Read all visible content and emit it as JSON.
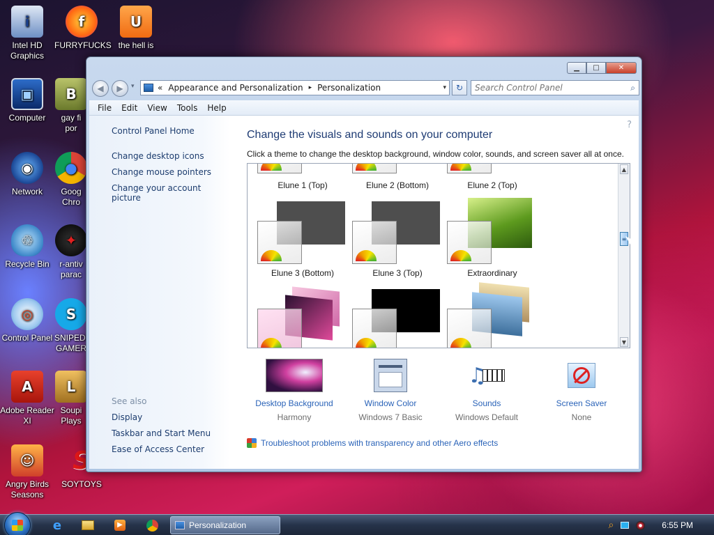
{
  "desktop": {
    "icons": [
      {
        "label": "Intel HD Graphics",
        "glyph": "i"
      },
      {
        "label": "FURRYFUCKS",
        "glyph": "f"
      },
      {
        "label": "the hell is",
        "glyph": "U"
      },
      {
        "label": "Computer",
        "glyph": "▣"
      },
      {
        "label": "gay fi por",
        "glyph": "B"
      },
      {
        "label": "Network",
        "glyph": "◉"
      },
      {
        "label": "Goog Chro",
        "glyph": "●"
      },
      {
        "label": "Recycle Bin",
        "glyph": "♲"
      },
      {
        "label": "r-antiv parac",
        "glyph": "✦"
      },
      {
        "label": "Control Panel",
        "glyph": "◎"
      },
      {
        "label": "SNIPED! GAMER",
        "glyph": "S"
      },
      {
        "label": "Adobe Reader XI",
        "glyph": "A"
      },
      {
        "label": "Soupi Plays",
        "glyph": "L"
      },
      {
        "label": "Angry Birds Seasons",
        "glyph": "☺"
      },
      {
        "label": "SOYTOYS",
        "glyph": "S"
      }
    ]
  },
  "window": {
    "title_controls": {
      "minimize": "▁",
      "maximize": "□",
      "close": "✕"
    },
    "nav": {
      "back": "◀",
      "forward": "▶",
      "history": "▾"
    },
    "address": {
      "lead": "«",
      "crumbs": [
        "Appearance and Personalization",
        "Personalization"
      ],
      "separator": "▸",
      "dropdown": "▾"
    },
    "refresh_glyph": "↻",
    "search": {
      "placeholder": "Search Control Panel",
      "icon": "⌕"
    },
    "menu": [
      "File",
      "Edit",
      "View",
      "Tools",
      "Help"
    ]
  },
  "sidebar": {
    "home": "Control Panel Home",
    "links": [
      "Change desktop icons",
      "Change mouse pointers",
      "Change your account picture"
    ],
    "see_also_heading": "See also",
    "see_also": [
      "Display",
      "Taskbar and Start Menu",
      "Ease of Access Center"
    ]
  },
  "main": {
    "help_glyph": "?",
    "title": "Change the visuals and sounds on your computer",
    "description": "Click a theme to change the desktop background, window color, sounds, and screen saver all at once.",
    "themes": [
      {
        "label": "Elune 1 (Top)",
        "style": "dark"
      },
      {
        "label": "Elune 2 (Bottom)",
        "style": "dark"
      },
      {
        "label": "Elune 2 (Top)",
        "style": "dark"
      },
      {
        "label": "Elune 3 (Bottom)",
        "style": "dark"
      },
      {
        "label": "Elune 3 (Top)",
        "style": "dark"
      },
      {
        "label": "Extraordinary",
        "style": "grass"
      },
      {
        "label": "",
        "style": "pinkstack"
      },
      {
        "label": "",
        "style": "black"
      },
      {
        "label": "",
        "style": "landscapestack"
      }
    ],
    "scroll": {
      "up": "▲",
      "down": "▼",
      "thumb": "≡"
    },
    "settings": [
      {
        "name": "Desktop Background",
        "value": "Harmony"
      },
      {
        "name": "Window Color",
        "value": "Windows 7 Basic"
      },
      {
        "name": "Sounds",
        "value": "Windows Default"
      },
      {
        "name": "Screen Saver",
        "value": "None"
      }
    ],
    "troubleshoot": "Troubleshoot problems with transparency and other Aero effects"
  },
  "taskbar": {
    "pinned": [
      "internet-explorer-icon",
      "folder-icon",
      "media-player-icon",
      "chrome-icon"
    ],
    "task_label": "Personalization",
    "clock": "6:55 PM"
  },
  "colors": {
    "link": "#2a63b8",
    "title": "#1e3b73",
    "sidebar_link": "#1c3c6e"
  }
}
